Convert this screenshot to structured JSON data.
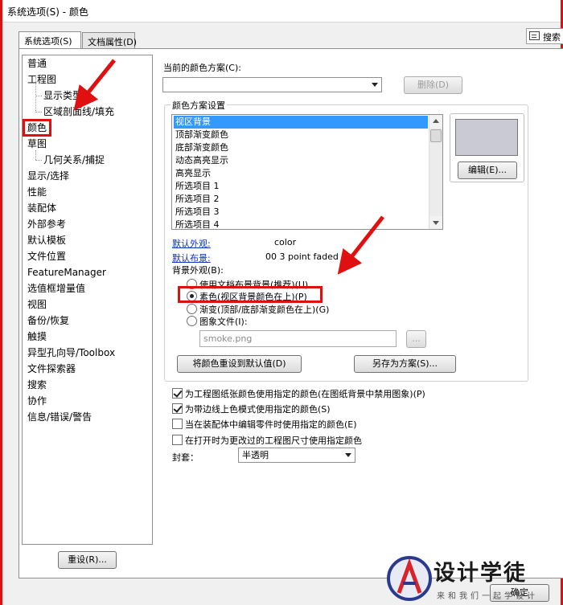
{
  "window": {
    "title": "系统选项(S) - 颜色"
  },
  "tabs": [
    {
      "label": "系统选项(S)"
    },
    {
      "label": "文档属性(D)"
    }
  ],
  "search": {
    "label": "搜索"
  },
  "tree": [
    {
      "label": "普通",
      "level": 1
    },
    {
      "label": "工程图",
      "level": 1
    },
    {
      "label": "显示类型",
      "level": 2
    },
    {
      "label": "区域剖面线/填充",
      "level": 2
    },
    {
      "label": "颜色",
      "level": 1,
      "selected": true
    },
    {
      "label": "草图",
      "level": 1
    },
    {
      "label": "几何关系/捕捉",
      "level": 2
    },
    {
      "label": "显示/选择",
      "level": 1
    },
    {
      "label": "性能",
      "level": 1
    },
    {
      "label": "装配体",
      "level": 1
    },
    {
      "label": "外部参考",
      "level": 1
    },
    {
      "label": "默认模板",
      "level": 1
    },
    {
      "label": "文件位置",
      "level": 1
    },
    {
      "label": "FeatureManager",
      "level": 1
    },
    {
      "label": "选值框增量值",
      "level": 1
    },
    {
      "label": "视图",
      "level": 1
    },
    {
      "label": "备份/恢复",
      "level": 1
    },
    {
      "label": "触摸",
      "level": 1
    },
    {
      "label": "异型孔向导/Toolbox",
      "level": 1
    },
    {
      "label": "文件探索器",
      "level": 1
    },
    {
      "label": "搜索",
      "level": 1
    },
    {
      "label": "协作",
      "level": 1
    },
    {
      "label": "信息/错误/警告",
      "level": 1
    }
  ],
  "scheme": {
    "label": "当前的颜色方案(C):",
    "value": "",
    "delete_label": "删除(D)"
  },
  "color_settings": {
    "title": "颜色方案设置",
    "items": [
      "视区背景",
      "顶部渐变颜色",
      "底部渐变颜色",
      "动态高亮显示",
      "高亮显示",
      "所选项目 1",
      "所选项目 2",
      "所选项目 3",
      "所选项目 4"
    ],
    "selected_index": 0,
    "edit_label": "编辑(E)...",
    "swatch_color": "#c9cad4"
  },
  "defaults": {
    "appearance_label": "默认外观:",
    "appearance_value": "color",
    "scene_label": "默认布景:",
    "scene_value": "00 3 point faded"
  },
  "background": {
    "label": "背景外观(B):",
    "options": [
      {
        "label": "使用文档布景背景(推荐)(U)",
        "checked": false
      },
      {
        "label": "素色(视区背景颜色在上)(P)",
        "checked": true
      },
      {
        "label": "渐变(顶部/底部渐变颜色在上)(G)",
        "checked": false
      },
      {
        "label": "图象文件(I):",
        "checked": false
      }
    ],
    "image_file": "smoke.png",
    "browse_label": "..."
  },
  "buttons": {
    "reset_colors": "将颜色重设到默认值(D)",
    "save_as": "另存为方案(S)...",
    "reset": "重设(R)...",
    "ok": "确定"
  },
  "checkboxes": [
    {
      "label": "为工程图纸张颜色使用指定的颜色(在图纸背景中禁用图象)(P)",
      "checked": true
    },
    {
      "label": "为带边线上色模式使用指定的颜色(S)",
      "checked": true
    },
    {
      "label": "当在装配体中编辑零件时使用指定的颜色(E)",
      "checked": false
    },
    {
      "label": "在打开时为更改过的工程图尺寸使用指定颜色",
      "checked": false
    }
  ],
  "envelope": {
    "label": "封套：",
    "value": "半透明"
  },
  "watermark": {
    "title": "设计学徒",
    "subtitle": "来和我们一起学设计"
  },
  "colors": {
    "accent_red": "#e01010",
    "selection_blue": "#3399ff",
    "link_blue": "#0a33b5"
  }
}
